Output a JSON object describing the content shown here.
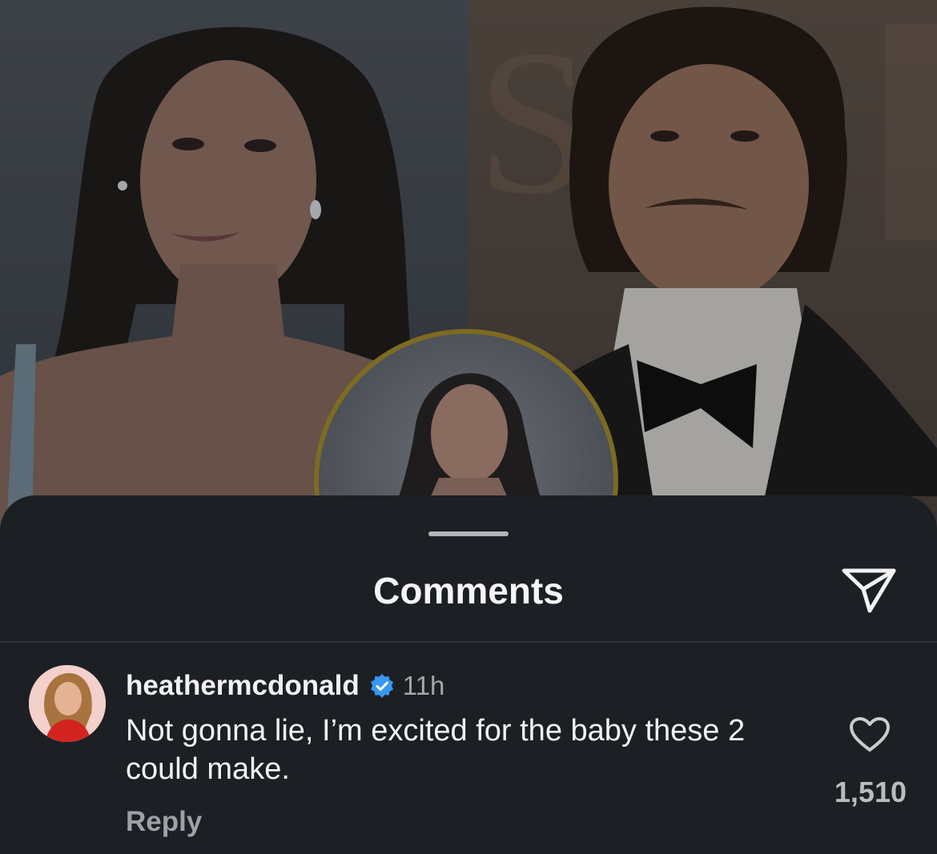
{
  "sheet": {
    "title": "Comments"
  },
  "comment": {
    "username": "heathermcdonald",
    "verified": true,
    "time": "11h",
    "text": "Not gonna lie, I’m excited for the baby these 2 could make.",
    "reply_label": "Reply",
    "like_count": "1,510"
  },
  "icons": {
    "share": "paper-plane-icon",
    "verified": "verified-badge-icon",
    "like": "heart-outline-icon"
  },
  "colors": {
    "sheet_bg": "#1c2024",
    "text": "#f2f2f2",
    "muted": "#a4a8ab",
    "verified_blue": "#3897f0",
    "story_ring": "#7d6b22"
  }
}
